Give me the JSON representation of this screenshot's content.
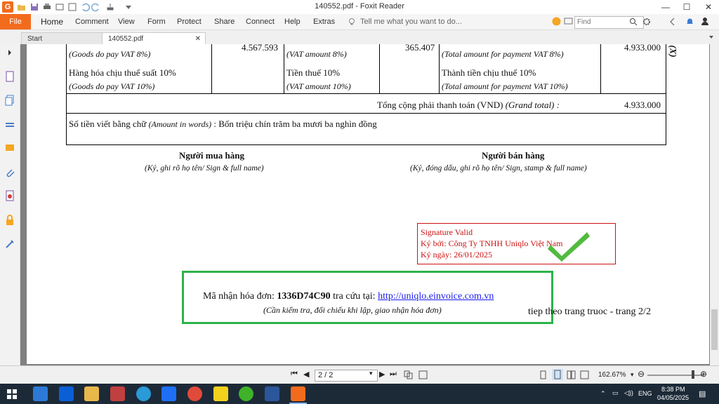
{
  "window": {
    "title": "140552.pdf - Foxit Reader",
    "app_logo": "G",
    "minimize": "—",
    "maximize": "☐",
    "close": "✕"
  },
  "menu": {
    "file": "File",
    "items": [
      "Home",
      "Comment",
      "View",
      "Form",
      "Protect",
      "Share",
      "Connect",
      "Help",
      "Extras"
    ],
    "tell_me": "Tell me what you want to do...",
    "find_placeholder": "Find"
  },
  "tabs": [
    {
      "label": "Start"
    },
    {
      "label": "140552.pdf"
    }
  ],
  "invoice": {
    "top_row": {
      "goods_8_en": "(Goods do pay VAT 8%)",
      "goods_8_amount": "4.567.593",
      "vat_8_en": "(VAT amount 8%)",
      "vat_8_amount": "365.407",
      "total_8_en": "(Total amount for payment VAT 8%)",
      "total_8_amount": "4.933.000"
    },
    "row_10": {
      "goods_10_vi": "Hàng hóa chịu thuế suất 10%",
      "goods_10_en": "(Goods do pay VAT 10%)",
      "vat_10_vi": "Tiền thuế 10%",
      "vat_10_en": "(VAT amount 10%)",
      "total_10_vi": "Thành tiền chịu thuế 10%",
      "total_10_en": "(Total amount for payment VAT 10%)"
    },
    "grand_total_label": "Tổng cộng phải thanh toán (VND)",
    "grand_total_label_en": "(Grand total) :",
    "grand_total_value": "4.933.000",
    "amount_words_label": "Số tiền viết bằng chữ",
    "amount_words_label_en": "(Amount in words)",
    "amount_words_value": ": Bốn triệu chín trăm ba mươi ba nghìn đồng",
    "buyer_title": "Người mua hàng",
    "buyer_sub": "(Ký, ghi rõ họ tên/ Sign & full name)",
    "seller_title": "Người bán hàng",
    "seller_sub": "(Ký, đóng dấu, ghi rõ họ tên/ Sign, stamp & full name)",
    "signature": {
      "line1": "Signature Valid",
      "line2": "Ký bởi: Công Ty TNHH Uniqlo Việt Nam",
      "line3": "Ký ngày: 26/01/2025"
    },
    "lookup": {
      "prefix": "Mã nhận hóa đơn:",
      "code": "1336D74C90",
      "middle": "tra cứu tại:",
      "url": "http://uniqlo.einvoice.com.vn",
      "note": "(Cần kiểm tra, đối chiếu khi lập, giao nhận hóa đơn)"
    },
    "continuation": "tiep theo trang truoc - trang 2/2",
    "side_glyph": "(X)"
  },
  "status": {
    "page_value": "2 / 2",
    "zoom": "162.67%"
  },
  "taskbar": {
    "lang": "ENG",
    "time": "8:38 PM",
    "date": "04/05/2025"
  },
  "colors": {
    "accent": "#f26b1d",
    "signature_red": "#cc1111",
    "lookup_border": "#2db34a",
    "check_green": "#3fb22a"
  }
}
